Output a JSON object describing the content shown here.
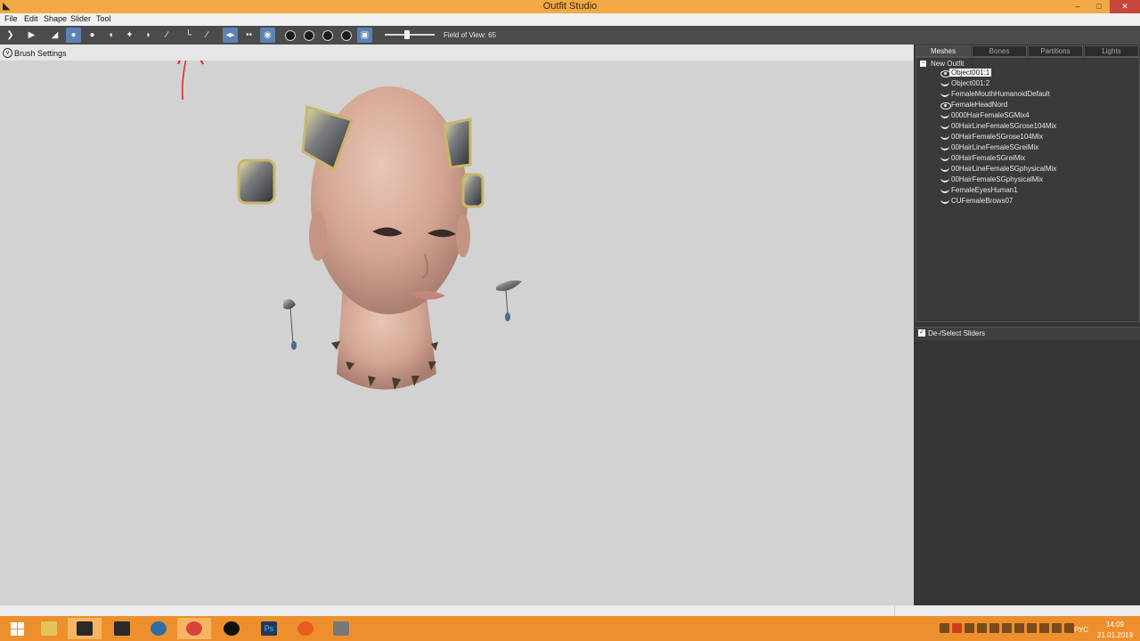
{
  "window": {
    "title": "Outfit Studio",
    "minimize": "–",
    "maximize": "□",
    "close": "✕"
  },
  "menu": [
    "File",
    "Edit",
    "Shape",
    "Slider",
    "Tool"
  ],
  "toolbar": {
    "field_of_view_label": "Field of View: 65",
    "field_of_view_value": 65
  },
  "brush_settings": {
    "label": "Brush Settings",
    "toggle": "∨"
  },
  "right_panel": {
    "tabs": [
      "Meshes",
      "Bones",
      "Partitions",
      "Lights"
    ],
    "active_tab": "Meshes",
    "tree_root": "New Outfit",
    "tree_root_toggle": "−",
    "meshes": [
      "Object001:1",
      "Object001:2",
      "FemaleMouthHumanoidDefault",
      "FemaleHeadNord",
      "0000HairFemaleSGMix4",
      "00HairLineFemaleSGrose104Mix",
      "00HairFemaleSGrose104Mix",
      "00HairLineFemaleSGreiMix",
      "00HairFemaleSGreiMix",
      "00HairLineFemaleSGphysicalMix",
      "00HairFemaleSGphysicalMix",
      "FemaleEyesHuman1",
      "CUFemaleBrows07"
    ],
    "selected_mesh": "Object001:1",
    "sliders_toggle_label": "De-/Select Sliders",
    "sliders_check": "✓"
  },
  "taskbar": {
    "apps": [
      "windows-start",
      "file-explorer",
      "outfit-studio",
      "bodyslide",
      "app-circle",
      "chrome",
      "yin-yang",
      "photoshop",
      "firefox",
      "app-box"
    ],
    "ps_label": "Ps",
    "language": "РУС",
    "time": "14:09",
    "date": "21.01.2019"
  }
}
